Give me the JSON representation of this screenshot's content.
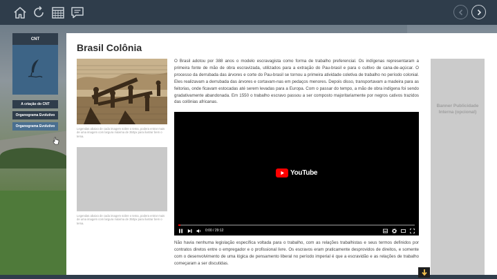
{
  "topbar": {
    "icons": [
      "home-icon",
      "refresh-icon",
      "calendar-icon",
      "chat-icon"
    ],
    "prev_icon": "chevron-left-icon",
    "next_icon": "chevron-right-icon"
  },
  "menu": {
    "header": "CNT",
    "logo_icon": "quill-pen-icon",
    "items": [
      {
        "label": "A criação do CNT"
      },
      {
        "label": "Organograma Evolutivo"
      },
      {
        "label": "Organograma Evolutivo"
      }
    ]
  },
  "content": {
    "title": "Brasil Colônia",
    "caption1": "Legendas abaixo de cada imagem sobre o tema, podera entrar mais de uma imagem com largura máxima de 350px para ilustrar bem o tema.",
    "caption2": "Legendas abaixo de cada imagem sobre o tema, podera entrar mais de uma imagem com largura máxima de 350px para ilustrar bem o tema.",
    "paragraph1": "O Brasil adotou por 388 anos o modelo escravagista como forma de trabalho preferencial. Os indígenas representaram a primeira fonte de mão de obra escravizada, utilizados para a extração do Pau-brasil e para o cultivo de cana-de-açúcar. O processo da derrubada das árvores e corte do Pau-brasil se tornou a primeira atividade coletiva de trabalho no período colonial. Eles realizavam a derrubada das árvores e cortavam-nas em pedaços menores. Depois disso, transportavam a madeira para as feitorias, onde ficavam estocadas até serem levadas para a Europa. Com o passar do tempo, a mão de obra indígena foi sendo gradativamente abandonada. Em 1550 o trabalho escravo passou a ser composto majoritariamente por negros cativos trazidos das colônias africanas.",
    "paragraph2": "Não havia nenhuma legislação específica voltada para o trabalho, com as relações trabalhistas e seus termos definidos por contratos diretos entre o empregador e o profissional livre. Os escravos eram praticamente desprovidos de direitos, e somente com o desenvolvimento de uma lógica de pensamento liberal no período imperial é que a escravidão e as relações de trabalho começaram a ser discutidas.",
    "banner": "Banner Publicidade Interna (opcional)"
  },
  "video": {
    "brand": "YouTube",
    "time": "0:00 / 29:12",
    "progress": 0.01
  }
}
